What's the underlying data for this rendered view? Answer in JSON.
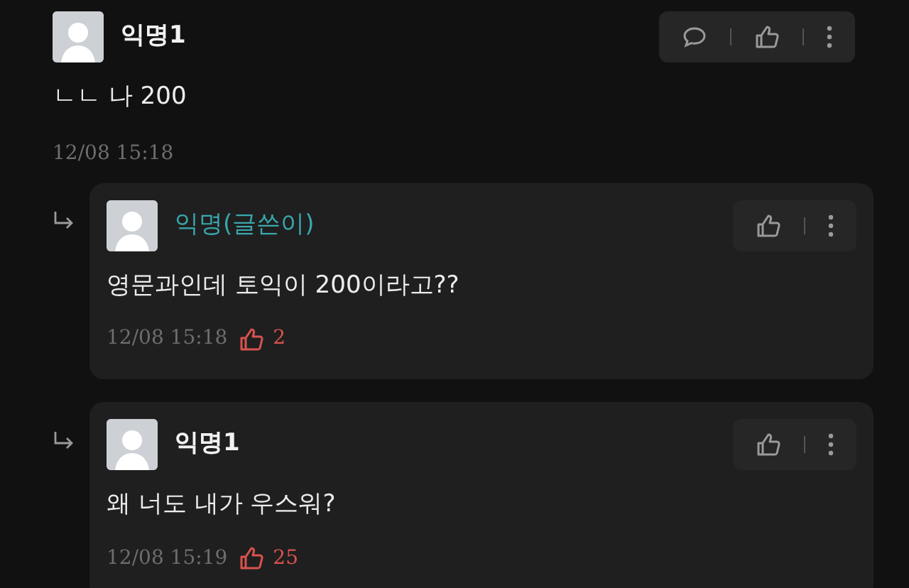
{
  "comments": [
    {
      "kind": "comment",
      "author": "익명1",
      "is_writer": false,
      "body": "ㄴㄴ 나 200",
      "time": "12/08 15:18",
      "reply_button": true
    },
    {
      "kind": "reply",
      "author": "익명(글쓴이)",
      "is_writer": true,
      "body": "영문과인데 토익이 200이라고??",
      "time": "12/08 15:18",
      "likes": "2",
      "reply_button": false
    },
    {
      "kind": "reply",
      "author": "익명1",
      "is_writer": false,
      "body": "왜 너도 내가 우스워?",
      "time": "12/08 15:19",
      "likes": "25",
      "reply_button": false
    }
  ]
}
